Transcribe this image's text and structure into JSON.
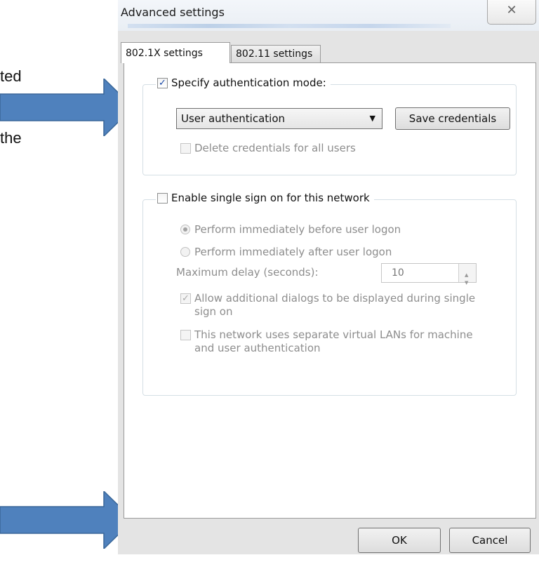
{
  "slide": {
    "fragment_1": "ted",
    "fragment_2": "the"
  },
  "dialog": {
    "title": "Advanced settings",
    "close_glyph": "✕"
  },
  "tabs": [
    {
      "label": "802.1X settings",
      "active": true
    },
    {
      "label": "802.11 settings",
      "active": false
    }
  ],
  "auth_group": {
    "label": "Specify authentication mode:",
    "checked": true,
    "mode_value": "User authentication",
    "save_credentials_label": "Save credentials",
    "delete_credentials_label": "Delete credentials for all users"
  },
  "sso_group": {
    "label": "Enable single sign on for this network",
    "checked": false,
    "radio_before": "Perform immediately before user logon",
    "radio_after": "Perform immediately after user logon",
    "max_delay_label": "Maximum delay (seconds):",
    "max_delay_value": "10",
    "allow_dialogs_line1": "Allow additional dialogs to be displayed during single",
    "allow_dialogs_line2": "sign on",
    "vlan_line1": "This network uses separate virtual LANs for machine",
    "vlan_line2": "and user authentication"
  },
  "buttons": {
    "ok": "OK",
    "cancel": "Cancel"
  },
  "icons": {
    "check": "✓",
    "dropdown": "▼",
    "spin_up": "▲",
    "spin_down": "▼",
    "arrow_color": "#4f81bd"
  }
}
